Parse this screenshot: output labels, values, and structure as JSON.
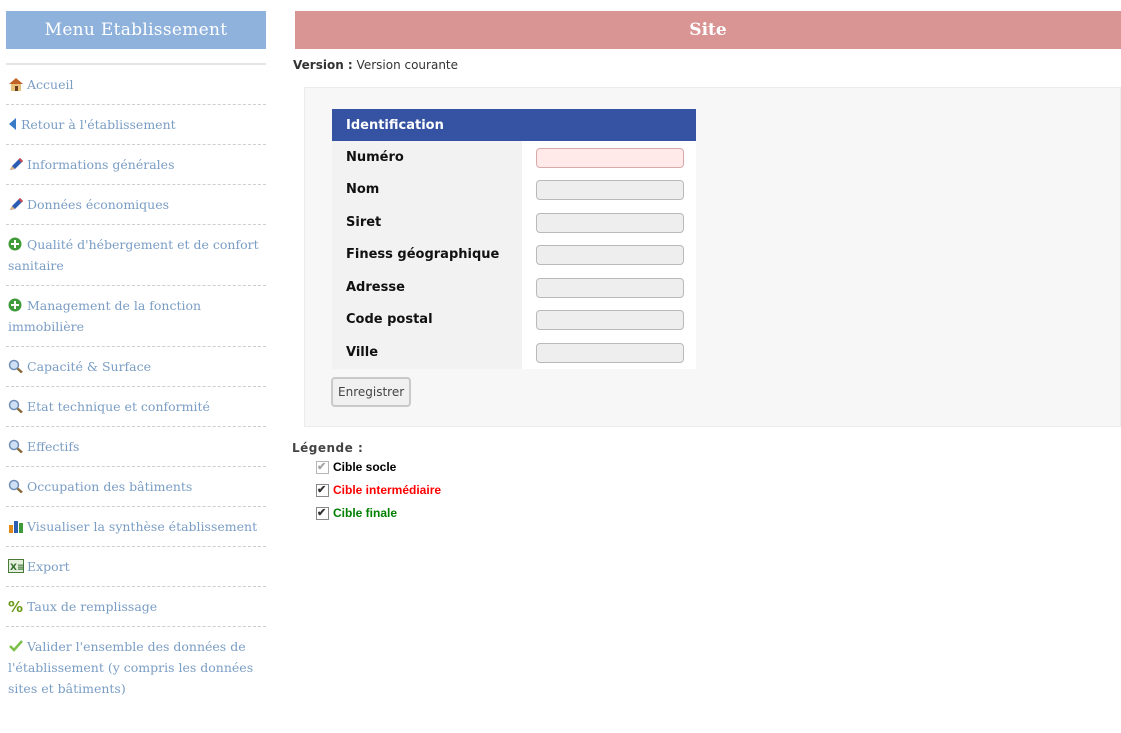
{
  "sidebar": {
    "title": "Menu Etablissement",
    "items": [
      {
        "label": "Accueil",
        "icon": "home-icon"
      },
      {
        "label": "Retour à l'établissement",
        "icon": "back-arrow-icon"
      },
      {
        "label": "Informations générales",
        "icon": "pencil-icon"
      },
      {
        "label": "Données économiques",
        "icon": "pencil-icon"
      },
      {
        "label": "Qualité d'hébergement et de confort sanitaire",
        "icon": "plus-circle-icon"
      },
      {
        "label": "Management de la fonction immobilière",
        "icon": "plus-circle-icon"
      },
      {
        "label": "Capacité & Surface",
        "icon": "magnifier-icon"
      },
      {
        "label": "Etat technique et conformité",
        "icon": "magnifier-icon"
      },
      {
        "label": "Effectifs",
        "icon": "magnifier-icon"
      },
      {
        "label": "Occupation des bâtiments",
        "icon": "magnifier-icon"
      },
      {
        "label": "Visualiser la synthèse établissement",
        "icon": "bar-chart-icon"
      },
      {
        "label": "Export",
        "icon": "excel-icon"
      },
      {
        "label": "Taux de remplissage",
        "icon": "percent-icon"
      },
      {
        "label": "Valider l'ensemble des données de l'établissement (y compris les données sites et bâtiments)",
        "icon": "checkmark-icon"
      }
    ]
  },
  "header": {
    "title": "Site"
  },
  "version": {
    "label": "Version :",
    "value": "Version courante"
  },
  "form": {
    "section_title": "Identification",
    "fields": [
      {
        "label": "Numéro",
        "value": ""
      },
      {
        "label": "Nom",
        "value": ""
      },
      {
        "label": "Siret",
        "value": ""
      },
      {
        "label": "Finess géographique",
        "value": ""
      },
      {
        "label": "Adresse",
        "value": ""
      },
      {
        "label": "Code postal",
        "value": ""
      },
      {
        "label": "Ville",
        "value": ""
      }
    ],
    "save_label": "Enregistrer"
  },
  "legend": {
    "title": "Légende :",
    "items": [
      {
        "label": "Cible socle",
        "color": "#000000"
      },
      {
        "label": "Cible intermédiaire",
        "color": "#ff0000"
      },
      {
        "label": "Cible finale",
        "color": "#008000"
      }
    ]
  },
  "colors": {
    "sidebar_title_bg": "#8fb2dc",
    "header_bg": "#d99594",
    "form_header_bg": "#3553a2",
    "menu_link": "#7a9dc4",
    "required_field_bg": "#ffe9e9"
  }
}
